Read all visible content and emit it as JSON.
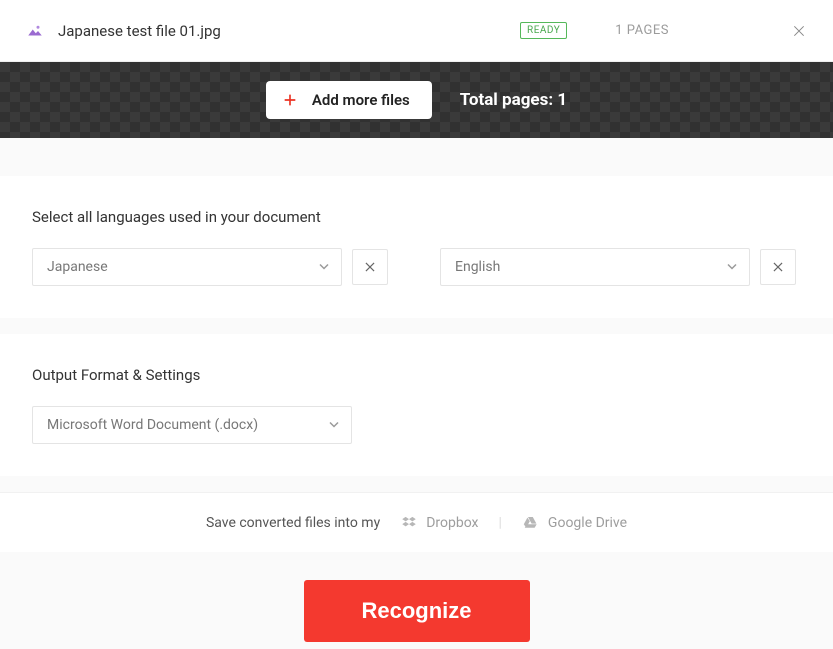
{
  "file": {
    "name": "Japanese test file 01.jpg",
    "status_badge": "READY",
    "pages_label": "1 PAGES"
  },
  "toolbar": {
    "add_more_label": "Add more files",
    "total_pages_label": "Total pages: 1"
  },
  "languages": {
    "title": "Select all languages used in your document",
    "items": [
      {
        "value": "Japanese"
      },
      {
        "value": "English"
      }
    ]
  },
  "output": {
    "title": "Output Format & Settings",
    "format_value": "Microsoft Word Document (.docx)"
  },
  "save": {
    "prompt": "Save converted files into my",
    "dropbox": "Dropbox",
    "google_drive": "Google Drive"
  },
  "actions": {
    "recognize_label": "Recognize"
  }
}
